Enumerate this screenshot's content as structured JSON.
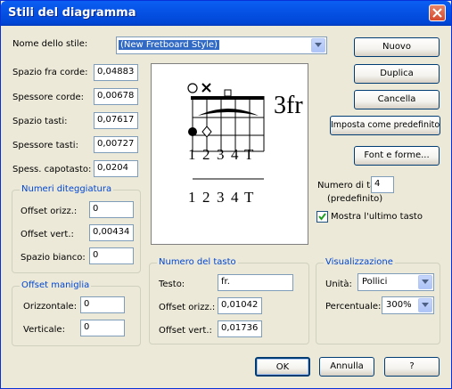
{
  "window": {
    "title": "Stili del diagramma"
  },
  "style_name": {
    "label": "Nome dello stile:",
    "value": "(New Fretboard Style)"
  },
  "buttons": {
    "new": "Nuovo",
    "duplicate": "Duplica",
    "delete": "Cancella",
    "set_default": "Imposta come predefinito",
    "fonts": "Font e forme...",
    "ok": "OK",
    "cancel": "Annulla",
    "help": "?"
  },
  "spacing": [
    {
      "label": "Spazio fra corde:",
      "value": "0,04883"
    },
    {
      "label": "Spessore corde:",
      "value": "0,00678"
    },
    {
      "label": "Spazio tasti:",
      "value": "0,07617"
    },
    {
      "label": "Spessore tasti:",
      "value": "0,00727"
    },
    {
      "label": "Spess. capotasto:",
      "value": "0,0204"
    }
  ],
  "fingering": {
    "title": "Numeri diteggiatura",
    "h_offset_label": "Offset orizz.:",
    "h_offset": "0",
    "v_offset_label": "Offset vert.:",
    "v_offset": "0,00434",
    "blank_label": "Spazio bianco:",
    "blank": "0"
  },
  "handle_offset": {
    "title": "Offset maniglia",
    "horizontal_label": "Orizzontale:",
    "horizontal": "0",
    "vertical_label": "Verticale:",
    "vertical": "0"
  },
  "fret_number": {
    "title": "Numero del tasto",
    "text_label": "Testo:",
    "text": "fr.",
    "h_offset_label": "Offset orizz.:",
    "h_offset": "0,01042",
    "v_offset_label": "Offset vert.:",
    "v_offset": "0,01736"
  },
  "display": {
    "title": "Visualizzazione",
    "unit_label": "Unità:",
    "unit": "Pollici",
    "percent_label": "Percentuale:",
    "percent": "300%"
  },
  "frets": {
    "count_label_1": "Numero di tasti:",
    "count_label_2": "(predefinito)",
    "count": "4",
    "show_last_label": "Mostra l'ultimo tasto",
    "show_last_checked": true
  },
  "preview": {
    "fret_label": "3fr",
    "finger_row_1": [
      "1",
      "2",
      "3",
      "4",
      "T"
    ],
    "finger_row_2": [
      "1",
      "2",
      "3",
      "4",
      "T"
    ]
  },
  "colors": {
    "title_bar": "#0054e3",
    "group_title": "#0046d5",
    "face": "#ece9d8"
  }
}
